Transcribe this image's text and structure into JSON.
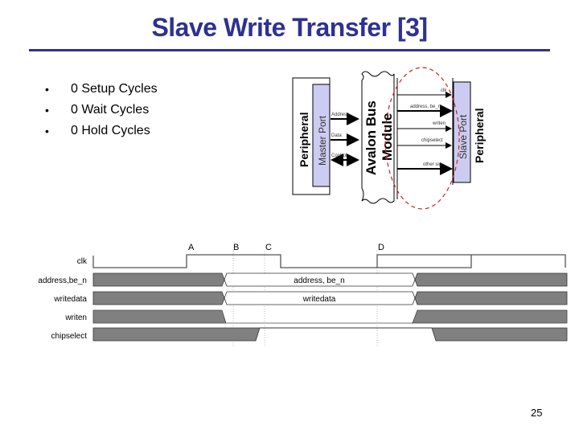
{
  "slide": {
    "title": "Slave Write Transfer [3]",
    "page_number": "25",
    "colors": {
      "title": "#2e3192",
      "port_fill": "#ccccf2",
      "bus_ellipse": "#cc2222",
      "signal_fill": "#808080"
    }
  },
  "bullets": [
    {
      "marker": "•",
      "text": "0 Setup Cycles"
    },
    {
      "marker": "•",
      "text": "0 Wait Cycles"
    },
    {
      "marker": "•",
      "text": "0 Hold Cycles"
    }
  ],
  "block_diagram": {
    "master_peripheral_label": "Peripheral",
    "master_port_label": "Master Port",
    "bus_label_line1": "Avalon Bus",
    "bus_label_line2": "Module",
    "slave_port_label": "Slave Port",
    "slave_peripheral_label": "Peripheral",
    "master_signals": [
      "Address",
      "Data",
      "Control"
    ],
    "slave_signals": [
      "clk",
      "address, be_n",
      "writen",
      "chipselect",
      "other sig"
    ]
  },
  "timing_diagram": {
    "markers": [
      "A",
      "B",
      "C",
      "D"
    ],
    "signals": [
      {
        "name": "clk"
      },
      {
        "name": "address,be_n",
        "value_label": "address, be_n"
      },
      {
        "name": "writedata",
        "value_label": "writedata"
      },
      {
        "name": "writen"
      },
      {
        "name": "chipselect"
      }
    ]
  }
}
